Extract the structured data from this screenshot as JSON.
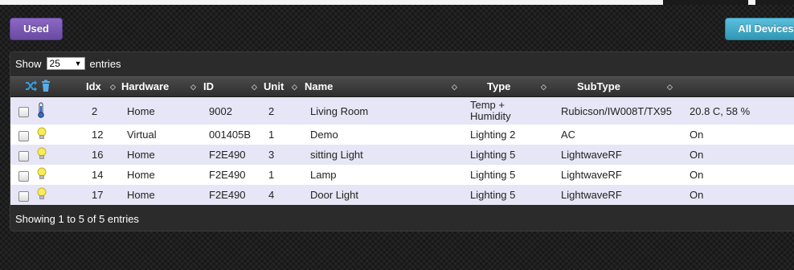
{
  "buttons": {
    "used": "Used",
    "all_devices": "All Devices"
  },
  "length_menu": {
    "show": "Show",
    "value": "25",
    "entries": "entries"
  },
  "columns": {
    "idx": "Idx",
    "hardware": "Hardware",
    "id": "ID",
    "unit": "Unit",
    "name": "Name",
    "type": "Type",
    "subtype": "SubType"
  },
  "rows": [
    {
      "icon": "thermometer-icon",
      "idx": "2",
      "hardware": "Home",
      "id": "9002",
      "unit": "2",
      "name": "Living Room",
      "type": "Temp + Humidity",
      "subtype": "Rubicson/IW008T/TX95",
      "data": "20.8 C, 58 %"
    },
    {
      "icon": "lightbulb-icon",
      "idx": "12",
      "hardware": "Virtual",
      "id": "001405B",
      "unit": "1",
      "name": "Demo",
      "type": "Lighting 2",
      "subtype": "AC",
      "data": "On"
    },
    {
      "icon": "lightbulb-icon",
      "idx": "16",
      "hardware": "Home",
      "id": "F2E490",
      "unit": "3",
      "name": "sitting Light",
      "type": "Lighting 5",
      "subtype": "LightwaveRF",
      "data": "On"
    },
    {
      "icon": "lightbulb-icon",
      "idx": "14",
      "hardware": "Home",
      "id": "F2E490",
      "unit": "1",
      "name": "Lamp",
      "type": "Lighting 5",
      "subtype": "LightwaveRF",
      "data": "On"
    },
    {
      "icon": "lightbulb-icon",
      "idx": "17",
      "hardware": "Home",
      "id": "F2E490",
      "unit": "4",
      "name": "Door Light",
      "type": "Lighting 5",
      "subtype": "LightwaveRF",
      "data": "On"
    }
  ],
  "footer": "Showing 1 to 5 of 5 entries",
  "colors": {
    "used_button": "#7a58b5",
    "all_devices_button": "#49afcd",
    "row_odd": "#e6e6f6",
    "row_even": "#ffffff"
  }
}
